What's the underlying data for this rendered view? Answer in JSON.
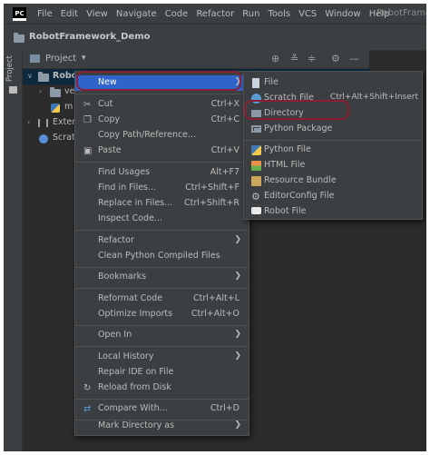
{
  "menubar": {
    "logo": "PC",
    "items": [
      "File",
      "Edit",
      "View",
      "Navigate",
      "Code",
      "Refactor",
      "Run",
      "Tools",
      "VCS",
      "Window",
      "Help"
    ],
    "app_title": "RobotFrame"
  },
  "pathbar": {
    "project_name": "RobotFramework_Demo"
  },
  "toolstrip": {
    "label": "Project"
  },
  "project_header": {
    "label": "Project",
    "caret": "▾"
  },
  "tree": {
    "root_label": "Robot",
    "venv_label": "ve",
    "file_label": "m",
    "external_label": "Extern",
    "scratches_label": "Scratc"
  },
  "context_menu": {
    "items": [
      {
        "label": "New",
        "shortcut": "",
        "submenu": true,
        "icon": ""
      },
      {
        "label": "Cut",
        "shortcut": "Ctrl+X",
        "submenu": false,
        "icon": "scissors-icon"
      },
      {
        "label": "Copy",
        "shortcut": "Ctrl+C",
        "submenu": false,
        "icon": "copy-icon"
      },
      {
        "label": "Copy Path/Reference...",
        "shortcut": "",
        "submenu": false,
        "icon": ""
      },
      {
        "label": "Paste",
        "shortcut": "Ctrl+V",
        "submenu": false,
        "icon": "paste-icon"
      },
      {
        "label": "Find Usages",
        "shortcut": "Alt+F7",
        "submenu": false,
        "icon": ""
      },
      {
        "label": "Find in Files...",
        "shortcut": "Ctrl+Shift+F",
        "submenu": false,
        "icon": ""
      },
      {
        "label": "Replace in Files...",
        "shortcut": "Ctrl+Shift+R",
        "submenu": false,
        "icon": ""
      },
      {
        "label": "Inspect Code...",
        "shortcut": "",
        "submenu": false,
        "icon": ""
      },
      {
        "label": "Refactor",
        "shortcut": "",
        "submenu": true,
        "icon": ""
      },
      {
        "label": "Clean Python Compiled Files",
        "shortcut": "",
        "submenu": false,
        "icon": ""
      },
      {
        "label": "Bookmarks",
        "shortcut": "",
        "submenu": true,
        "icon": ""
      },
      {
        "label": "Reformat Code",
        "shortcut": "Ctrl+Alt+L",
        "submenu": false,
        "icon": ""
      },
      {
        "label": "Optimize Imports",
        "shortcut": "Ctrl+Alt+O",
        "submenu": false,
        "icon": ""
      },
      {
        "label": "Open In",
        "shortcut": "",
        "submenu": true,
        "icon": ""
      },
      {
        "label": "Local History",
        "shortcut": "",
        "submenu": true,
        "icon": ""
      },
      {
        "label": "Repair IDE on File",
        "shortcut": "",
        "submenu": false,
        "icon": ""
      },
      {
        "label": "Reload from Disk",
        "shortcut": "",
        "submenu": false,
        "icon": "reload-icon"
      },
      {
        "label": "Compare With...",
        "shortcut": "Ctrl+D",
        "submenu": false,
        "icon": "compare-icon"
      },
      {
        "label": "Mark Directory as",
        "shortcut": "",
        "submenu": true,
        "icon": ""
      }
    ]
  },
  "new_submenu": {
    "items": [
      {
        "label": "File",
        "shortcut": "",
        "icon": "file-icon"
      },
      {
        "label": "Scratch File",
        "shortcut": "Ctrl+Alt+Shift+Insert",
        "icon": "scratch-file-icon"
      },
      {
        "label": "Directory",
        "shortcut": "",
        "icon": "directory-icon"
      },
      {
        "label": "Python Package",
        "shortcut": "",
        "icon": "python-package-icon"
      },
      {
        "label": "Python File",
        "shortcut": "",
        "icon": "python-file-icon"
      },
      {
        "label": "HTML File",
        "shortcut": "",
        "icon": "html-file-icon"
      },
      {
        "label": "Resource Bundle",
        "shortcut": "",
        "icon": "resource-bundle-icon"
      },
      {
        "label": "EditorConfig File",
        "shortcut": "",
        "icon": "editorconfig-icon"
      },
      {
        "label": "Robot File",
        "shortcut": "",
        "icon": "robot-file-icon"
      }
    ]
  },
  "colors": {
    "highlight": "#2f65ca",
    "annotation": "#8a1e33",
    "background": "#2b2b2b",
    "menu": "#3c3f41"
  }
}
